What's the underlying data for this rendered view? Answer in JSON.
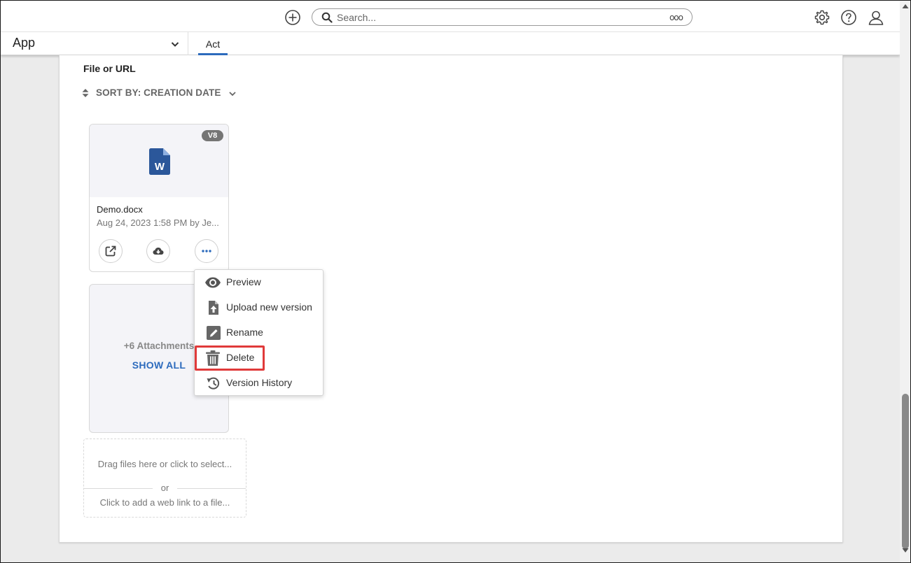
{
  "topbar": {
    "search_placeholder": "Search...",
    "search_options_glyph": "ooo"
  },
  "appbar": {
    "app_label": "App",
    "tab_label": "Act"
  },
  "content": {
    "section_label": "File or URL",
    "sort_label": "SORT BY: CREATION DATE"
  },
  "file": {
    "version": "V8",
    "name": "Demo.docx",
    "meta": "Aug 24, 2023 1:58 PM by Je..."
  },
  "attachments": {
    "count_label": "+6 Attachments",
    "show_all": "SHOW ALL"
  },
  "dropzone": {
    "drag_text": "Drag files here or click to select...",
    "or_text": "or",
    "link_text": "Click to add a web link to a file..."
  },
  "menu": {
    "items": [
      {
        "label": "Preview",
        "icon": "eye-icon"
      },
      {
        "label": "Upload new version",
        "icon": "upload-file-icon"
      },
      {
        "label": "Rename",
        "icon": "pencil-icon"
      },
      {
        "label": "Delete",
        "icon": "trash-icon"
      },
      {
        "label": "Version History",
        "icon": "history-icon"
      }
    ]
  },
  "colors": {
    "accent": "#2d6bbd",
    "word_blue": "#2b579a",
    "highlight": "#e03a3a"
  }
}
